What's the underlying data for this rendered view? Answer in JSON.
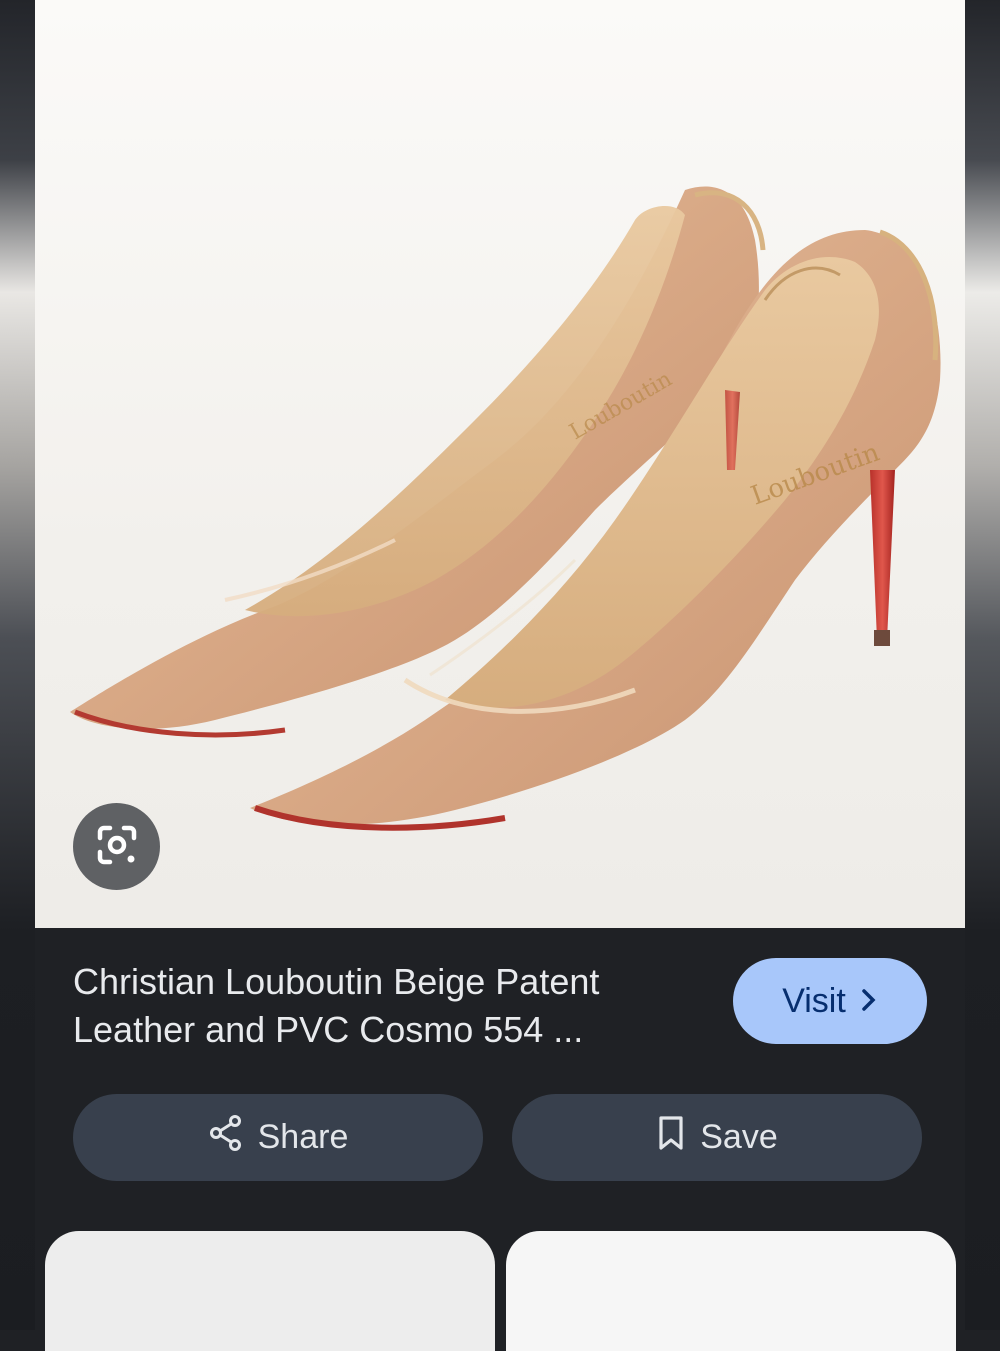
{
  "result": {
    "image_alt": "Beige patent leather and PVC pointed pumps",
    "title": "Christian Louboutin Beige Patent Leather and PVC Cosmo 554 ..."
  },
  "actions": {
    "visit_label": "Visit",
    "share_label": "Share",
    "save_label": "Save"
  },
  "icons": {
    "lens": "lens-camera-icon",
    "visit_arrow": "chevron-right-icon",
    "share": "share-icon",
    "save": "bookmark-icon"
  },
  "colors": {
    "panel_bg": "#1f2125",
    "visit_bg": "#a8c7fa",
    "pill_bg": "#38404d",
    "text": "#e8eaed"
  }
}
